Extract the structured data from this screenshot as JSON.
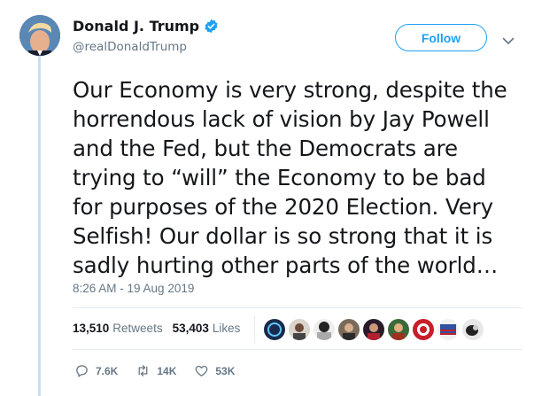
{
  "user": {
    "name": "Donald J. Trump",
    "handle": "@realDonaldTrump",
    "avatar_icon": "profile-photo",
    "verified_icon": "verified-badge-icon"
  },
  "follow_button": {
    "label": "Follow"
  },
  "tweet": {
    "lines": [
      "Our Economy is very strong, despite the",
      "horrendous lack of vision by Jay Powell",
      "and the Fed, but the Democrats are",
      "trying to “will” the Economy to be bad",
      "for purposes of the 2020 Election.  Very",
      "Selfish! Our dollar is so strong that it is",
      "sadly hurting other parts of the world…"
    ],
    "timestamp": "8:26 AM - 19 Aug 2019"
  },
  "stats": {
    "retweets_count": "13,510",
    "retweets_label": "Retweets",
    "likes_count": "53,403",
    "likes_label": "Likes"
  },
  "actions": {
    "reply_count": "7.6K",
    "retweet_count": "14K",
    "like_count": "53K"
  },
  "colors": {
    "accent": "#1da1f2",
    "secondary_text": "#657786",
    "thread_line": "#c4dff6"
  }
}
